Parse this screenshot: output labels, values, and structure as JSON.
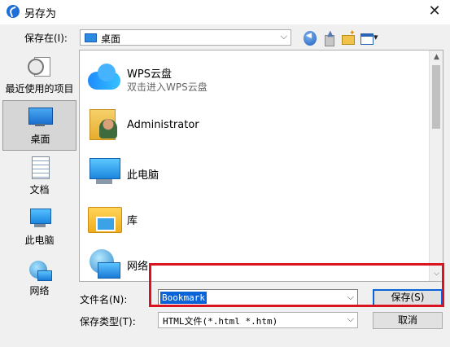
{
  "window": {
    "title": "另存为",
    "close": "✕"
  },
  "lookin": {
    "label": "保存在(I):",
    "value": "桌面"
  },
  "places": [
    {
      "label": "最近使用的项目"
    },
    {
      "label": "桌面"
    },
    {
      "label": "文档"
    },
    {
      "label": "此电脑"
    },
    {
      "label": "网络"
    }
  ],
  "files": [
    {
      "name": "WPS云盘",
      "sub": "双击进入WPS云盘"
    },
    {
      "name": "Administrator"
    },
    {
      "name": "此电脑"
    },
    {
      "name": "库"
    },
    {
      "name": "网络"
    }
  ],
  "filename": {
    "label": "文件名(N):",
    "value": "Bookmark"
  },
  "filetype": {
    "label": "保存类型(T):",
    "value": "HTML文件(*.html *.htm)"
  },
  "buttons": {
    "save": "保存(S)",
    "cancel": "取消"
  },
  "colors": {
    "accent": "#0a64d8",
    "highlight": "#d9131f"
  }
}
